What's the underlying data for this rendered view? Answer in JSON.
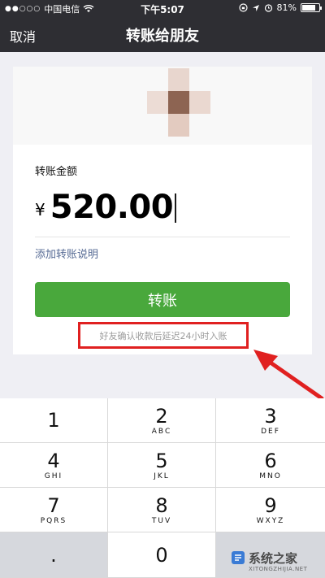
{
  "status_bar": {
    "signal_dots": "●●○○○",
    "carrier": "中国电信",
    "time": "下午5:07",
    "battery": "81%",
    "battery_level": 0.81
  },
  "nav": {
    "cancel": "取消",
    "title": "转账给朋友"
  },
  "form": {
    "amount_label": "转账金额",
    "currency": "¥",
    "amount": "520.00",
    "note_link": "添加转账说明",
    "submit": "转账",
    "hint": "好友确认收款后延迟24小时入账"
  },
  "keypad": [
    {
      "num": "1",
      "letters": ""
    },
    {
      "num": "2",
      "letters": "ABC"
    },
    {
      "num": "3",
      "letters": "DEF"
    },
    {
      "num": "4",
      "letters": "GHI"
    },
    {
      "num": "5",
      "letters": "JKL"
    },
    {
      "num": "6",
      "letters": "MNO"
    },
    {
      "num": "7",
      "letters": "PQRS"
    },
    {
      "num": "8",
      "letters": "TUV"
    },
    {
      "num": "9",
      "letters": "WXYZ"
    },
    {
      "num": ".",
      "letters": ""
    },
    {
      "num": "0",
      "letters": ""
    }
  ],
  "watermark": {
    "text": "系统之家",
    "url": "XITONGZHIJIA.NET"
  },
  "colors": {
    "nav_bg": "#2e2e33",
    "button_green": "#49a83c",
    "link_blue": "#576b95",
    "highlight_red": "#e02020"
  }
}
